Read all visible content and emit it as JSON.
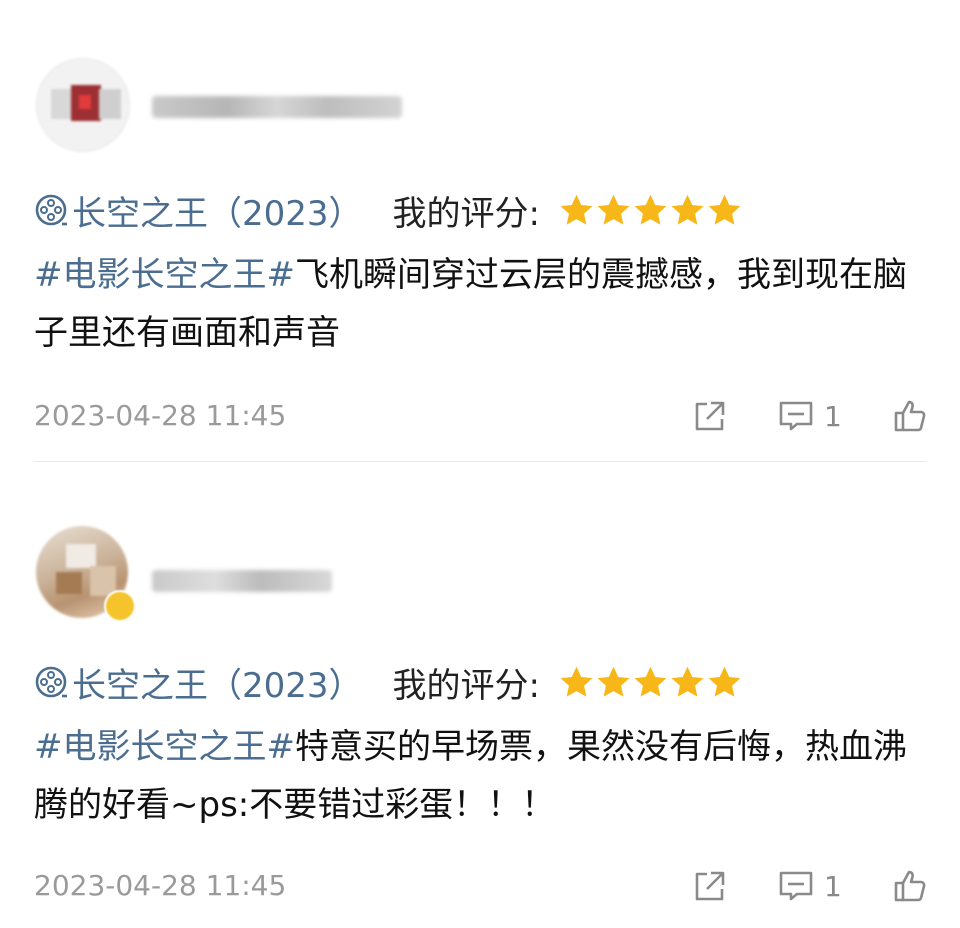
{
  "posts": [
    {
      "movie_title": "长空之王（2023）",
      "rating_label": "我的评分:",
      "rating": 5,
      "hashtag": "#电影长空之王#",
      "text": "飞机瞬间穿过云层的震撼感，我到现在脑子里还有画面和声音",
      "date": "2023-04-28 11:45",
      "comment_count": "1"
    },
    {
      "movie_title": "长空之王（2023）",
      "rating_label": "我的评分:",
      "rating": 5,
      "hashtag": "#电影长空之王#",
      "text": "特意买的早场票，果然没有后悔，热血沸腾的好看~ps:不要错过彩蛋！！！",
      "date": "2023-04-28 11:45",
      "comment_count": "1"
    }
  ],
  "colors": {
    "link": "#4a6d90",
    "star": "#f7b718",
    "meta": "#9a9a9a"
  },
  "icons": [
    "film-reel-icon",
    "star-icon",
    "share-icon",
    "comment-icon",
    "like-icon"
  ]
}
